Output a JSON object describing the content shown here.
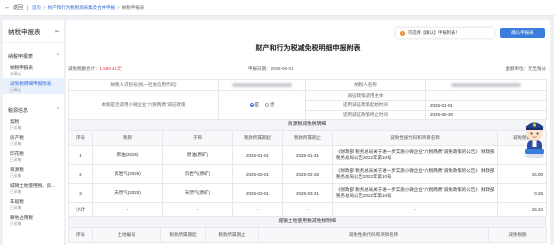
{
  "topbar": {
    "back_label": "返回",
    "breadcrumb": [
      "首页",
      "财产和行为税税源采集及合并申报",
      "纳税申报表"
    ]
  },
  "sidebar": {
    "title": "纳税申报表",
    "sections": [
      {
        "label": "纳税申报表",
        "items": [
          {
            "label": "纳税申报表",
            "status": "未确认"
          },
          {
            "label": "减免税明细申报附表",
            "status": "已确认"
          }
        ]
      },
      {
        "label": "税源信息",
        "items": [
          {
            "label": "契税",
            "status": "已采集"
          },
          {
            "label": "房产税",
            "status": "已采集"
          },
          {
            "label": "印花税",
            "status": "已采集"
          },
          {
            "label": "资源税",
            "status": "已采集"
          },
          {
            "label": "城镇土地使用税、房...",
            "status": "已采集"
          },
          {
            "label": "车船税",
            "status": "已采集"
          },
          {
            "label": "耕地占用税",
            "status": "已采集"
          }
        ]
      }
    ]
  },
  "main": {
    "title": "财产和行为税减免税明细申报附表",
    "notice": "可选择【确认】申报附表！",
    "confirm_button": "确认申报表",
    "total_label": "减免税额合计：",
    "total_value": "1,559.41元",
    "date_label": "申报日期：",
    "date_value": "2025-06-01",
    "unit_label": "金额单位：元至角分"
  },
  "form": {
    "taxpayer_id_label": "纳税人识别号(统一社会信用代码)",
    "taxpayer_name_label": "纳税人名称",
    "policy_label": "本期是否适用小微企业“六税两费”减征政策",
    "policy_options": [
      "是",
      "否"
    ],
    "policy_selected": "是",
    "subject_label": "减征政策适用主体",
    "subject_value": "",
    "start_label": "适用减征政策起始时间",
    "start_value": "2025-01-01",
    "end_label": "适用减征政策终止时间",
    "end_value": "2025-06-30"
  },
  "table1": {
    "title": "资源税减免税明细",
    "headers": [
      "序号",
      "税目",
      "子目",
      "税款所属期起",
      "税款所属期止",
      "减免性质代码和项目名称",
      "减免税额"
    ],
    "rows": [
      {
        "seq": "1",
        "item": "原油(2025)",
        "subitem": "原油(原矿)",
        "start": "2025-01-01",
        "end": "2025-01-31",
        "policy": "《财政部 税务总局关于进一步实施小微企业“六税两费”减免政策的公告》 财政部 税务总局公告2022年第10号",
        "amount": "0.09"
      },
      {
        "seq": "2",
        "item": "页岩气(2025)",
        "subitem": "页岩气(原矿)",
        "start": "2025-02-01",
        "end": "2025-02-28",
        "policy": "《财政部 税务总局关于进一步实施小微企业“六税两费”减免政策的公告》 财政部 税务总局公告2022年第10号",
        "amount": "15.00"
      },
      {
        "seq": "3",
        "item": "天然气(2025)",
        "subitem": "天然气(原矿)",
        "start": "2025-03-01",
        "end": "2025-03-31",
        "policy": "《财政部 税务总局关于进一步实施小微企业“六税两费”减免政策的公告》 财政部 税务总局公告2022年第10号",
        "amount": "0.25"
      }
    ],
    "subtotal": {
      "seq": "小计",
      "item": "-",
      "subitem": "-",
      "start": "-",
      "end": "-",
      "policy": "-",
      "amount": "15.34"
    }
  },
  "table2": {
    "title": "城镇土地使用税减免税明细",
    "headers": [
      "序号",
      "土地编号",
      "税款所属期起",
      "税款所属期止",
      "减免性质代码和项目名称",
      "减免税额"
    ]
  },
  "colors": {
    "accent": "#3b7ddd",
    "link": "#2f6bd6",
    "warning": "#f08a24",
    "total": "#e23c3c"
  }
}
